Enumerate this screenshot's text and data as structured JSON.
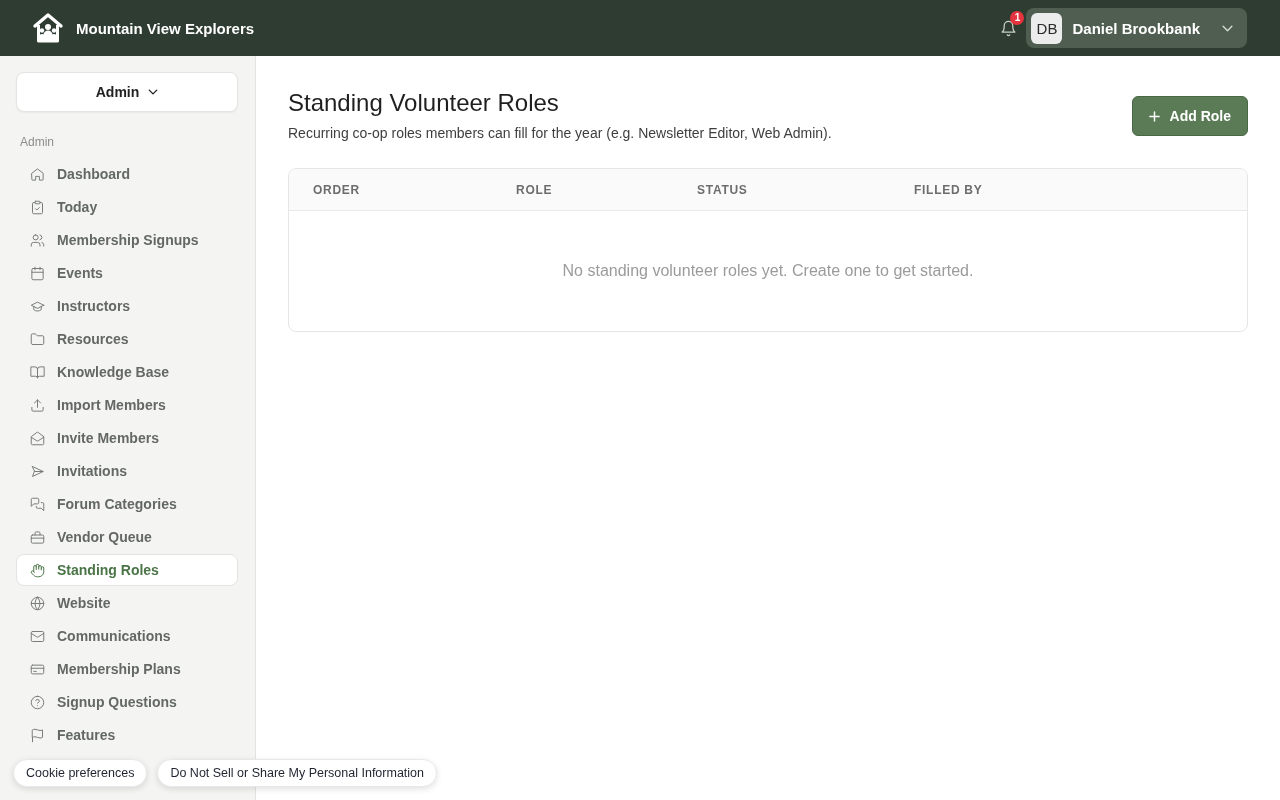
{
  "header": {
    "app_name": "Mountain View Explorers",
    "notifications": {
      "count": "1"
    },
    "user": {
      "initials": "DB",
      "name": "Daniel Brookbank"
    }
  },
  "sidebar": {
    "switcher": {
      "label": "Admin"
    },
    "section_label": "Admin",
    "items": [
      {
        "label": "Dashboard",
        "selected": false
      },
      {
        "label": "Today",
        "selected": false
      },
      {
        "label": "Membership Signups",
        "selected": false
      },
      {
        "label": "Events",
        "selected": false
      },
      {
        "label": "Instructors",
        "selected": false
      },
      {
        "label": "Resources",
        "selected": false
      },
      {
        "label": "Knowledge Base",
        "selected": false
      },
      {
        "label": "Import Members",
        "selected": false
      },
      {
        "label": "Invite Members",
        "selected": false
      },
      {
        "label": "Invitations",
        "selected": false
      },
      {
        "label": "Forum Categories",
        "selected": false
      },
      {
        "label": "Vendor Queue",
        "selected": false
      },
      {
        "label": "Standing Roles",
        "selected": true
      },
      {
        "label": "Website",
        "selected": false
      },
      {
        "label": "Communications",
        "selected": false
      },
      {
        "label": "Membership Plans",
        "selected": false
      },
      {
        "label": "Signup Questions",
        "selected": false
      },
      {
        "label": "Features",
        "selected": false
      }
    ]
  },
  "page": {
    "title": "Standing Volunteer Roles",
    "subtitle": "Recurring co-op roles members can fill for the year (e.g. Newsletter Editor, Web Admin).",
    "add_button": {
      "label": "Add Role"
    }
  },
  "table": {
    "columns": [
      "ORDER",
      "ROLE",
      "STATUS",
      "FILLED BY"
    ],
    "empty_message": "No standing volunteer roles yet. Create one to get started."
  },
  "cookie_bar": {
    "buttons": [
      "Cookie preferences",
      "Do Not Sell or Share My Personal Information"
    ]
  }
}
